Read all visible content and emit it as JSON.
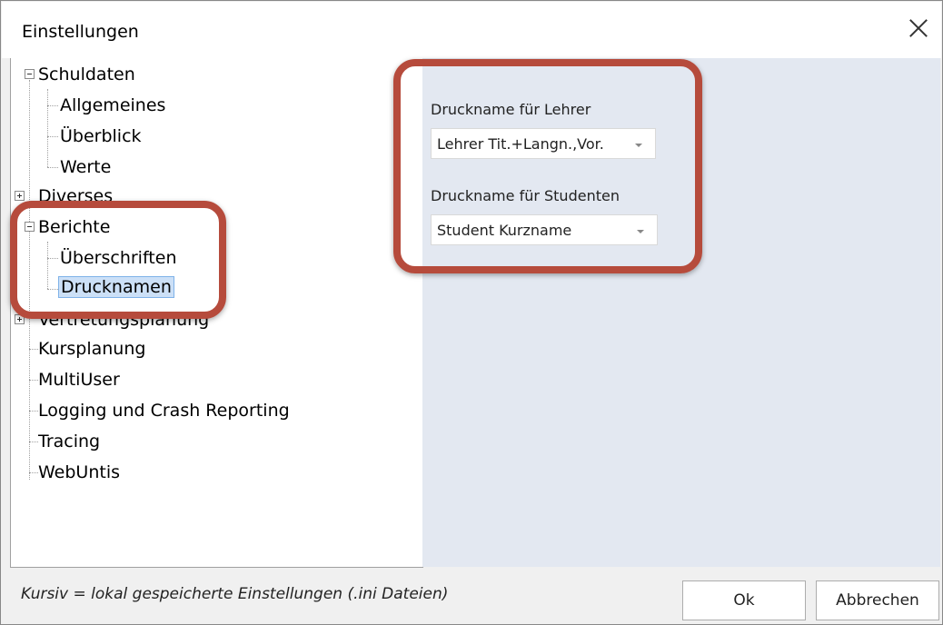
{
  "window": {
    "title": "Einstellungen"
  },
  "tree": {
    "items": [
      {
        "label": "Schuldaten"
      },
      {
        "label": "Allgemeines"
      },
      {
        "label": "Überblick"
      },
      {
        "label": "Werte"
      },
      {
        "label": "Diverses"
      },
      {
        "label": "Berichte"
      },
      {
        "label": "Überschriften"
      },
      {
        "label": "Drucknamen"
      },
      {
        "label": "Vertretungsplanung"
      },
      {
        "label": "Kursplanung"
      },
      {
        "label": "MultiUser"
      },
      {
        "label": "Logging und Crash Reporting"
      },
      {
        "label": "Tracing"
      },
      {
        "label": "WebUntis"
      }
    ],
    "selected": "Drucknamen"
  },
  "settings": {
    "teacher": {
      "label": "Druckname für Lehrer",
      "value": "Lehrer Tit.+Langn.,Vor."
    },
    "student": {
      "label": "Druckname für Studenten",
      "value": "Student Kurzname"
    }
  },
  "footer": {
    "hint": "Kursiv = lokal gespeicherte Einstellungen (.ini Dateien)",
    "ok_label": "Ok",
    "cancel_label": "Abbrechen"
  },
  "colors": {
    "highlight": "#b64b3c",
    "panel": "#e3e8f1",
    "selection": "#cce0f7"
  }
}
